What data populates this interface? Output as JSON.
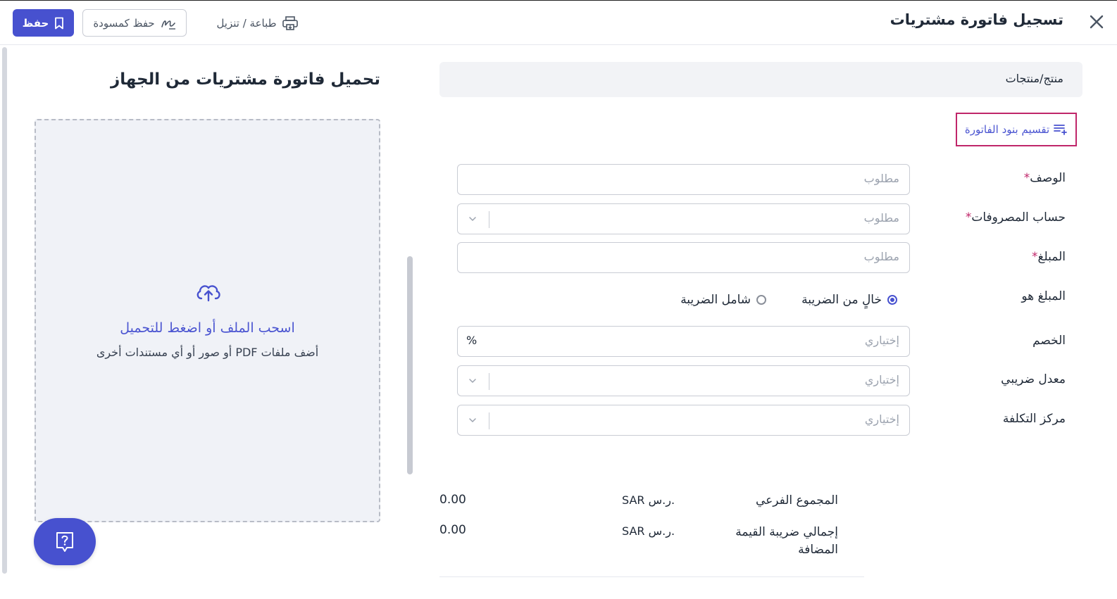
{
  "header": {
    "title": "تسجيل فاتورة مشتريات",
    "save_label": "حفظ",
    "save_draft_label": "حفظ كمسودة",
    "print_label": "طباعة / تنزيل"
  },
  "upload": {
    "title": "تحميل فاتورة مشتريات من الجهاز",
    "drop_title": "اسحب الملف أو اضغط للتحميل",
    "drop_subtitle": "أضف ملفات PDF أو صور أو أي مستندات أخرى"
  },
  "form": {
    "section_title": "منتج/منتجات",
    "split_items_label": "تقسيم بنود الفاتورة",
    "required_marker": "*",
    "description": {
      "label": "الوصف",
      "placeholder": "مطلوب"
    },
    "expense_account": {
      "label": "حساب المصروفات",
      "placeholder": "مطلوب"
    },
    "amount": {
      "label": "المبلغ",
      "placeholder": "مطلوب"
    },
    "amount_is": {
      "label": "المبلغ هو",
      "options": [
        "خالٍ من الضريبة",
        "شامل الضريبة"
      ],
      "selected": "خالٍ من الضريبة"
    },
    "discount": {
      "label": "الخصم",
      "placeholder": "إختياري",
      "unit": "%"
    },
    "tax_rate": {
      "label": "معدل ضريبي",
      "placeholder": "إختياري"
    },
    "cost_center": {
      "label": "مركز التكلفة",
      "placeholder": "إختياري"
    }
  },
  "summary": {
    "subtotal": {
      "label": "المجموع الفرعي",
      "currency": "SAR ر.س.",
      "value": "0.00"
    },
    "vat_total": {
      "label": "إجمالي ضريبة القيمة المضافة",
      "currency": "SAR ر.س.",
      "value": "0.00"
    }
  },
  "colors": {
    "primary": "#4751cf",
    "required": "#c0266a",
    "highlight_border": "#c0266a"
  },
  "icons": [
    "close-icon",
    "bookmark-icon",
    "draft-signature-icon",
    "printer-icon",
    "cloud-upload-icon",
    "help-icon",
    "list-add-icon",
    "chevron-down-icon"
  ]
}
